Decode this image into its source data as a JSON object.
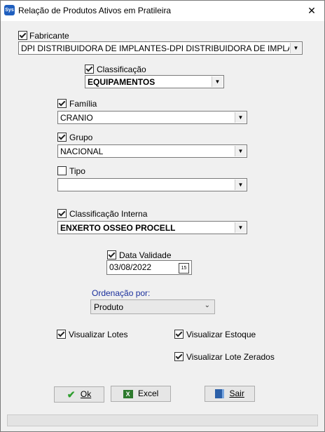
{
  "window": {
    "title": "Relação de Produtos Ativos em Pratileira",
    "app_icon_text": "Sys",
    "close_glyph": "✕"
  },
  "fabricante": {
    "label": "Fabricante",
    "checked": true,
    "value": "DPI DISTRIBUIDORA DE IMPLANTES-DPI DISTRIBUIDORA DE IMPLANTES LTDA"
  },
  "classificacao": {
    "label": "Classificação",
    "checked": true,
    "value": "EQUIPAMENTOS"
  },
  "familia": {
    "label": "Família",
    "checked": true,
    "value": "CRANIO"
  },
  "grupo": {
    "label": "Grupo",
    "checked": true,
    "value": "NACIONAL"
  },
  "tipo": {
    "label": "Tipo",
    "checked": false,
    "value": ""
  },
  "classificacao_interna": {
    "label": "Classificação Interna",
    "checked": true,
    "value": "ENXERTO OSSEO PROCELL"
  },
  "data_validade": {
    "label": "Data Validade",
    "checked": true,
    "value": "03/08/2022",
    "calendar_glyph": "15"
  },
  "ordenacao": {
    "label": "Ordenação por:",
    "value": "Produto"
  },
  "options": {
    "visualizar_lotes": "Visualizar Lotes",
    "visualizar_estoque": "Visualizar Estoque",
    "visualizar_lote_zerados": "Visualizar Lote Zerados"
  },
  "buttons": {
    "ok": "Ok",
    "excel": "Excel",
    "sair": "Sair"
  },
  "colors": {
    "ok_icon": "#2e9e2e",
    "ordenacao_label": "#1a2f9c"
  }
}
